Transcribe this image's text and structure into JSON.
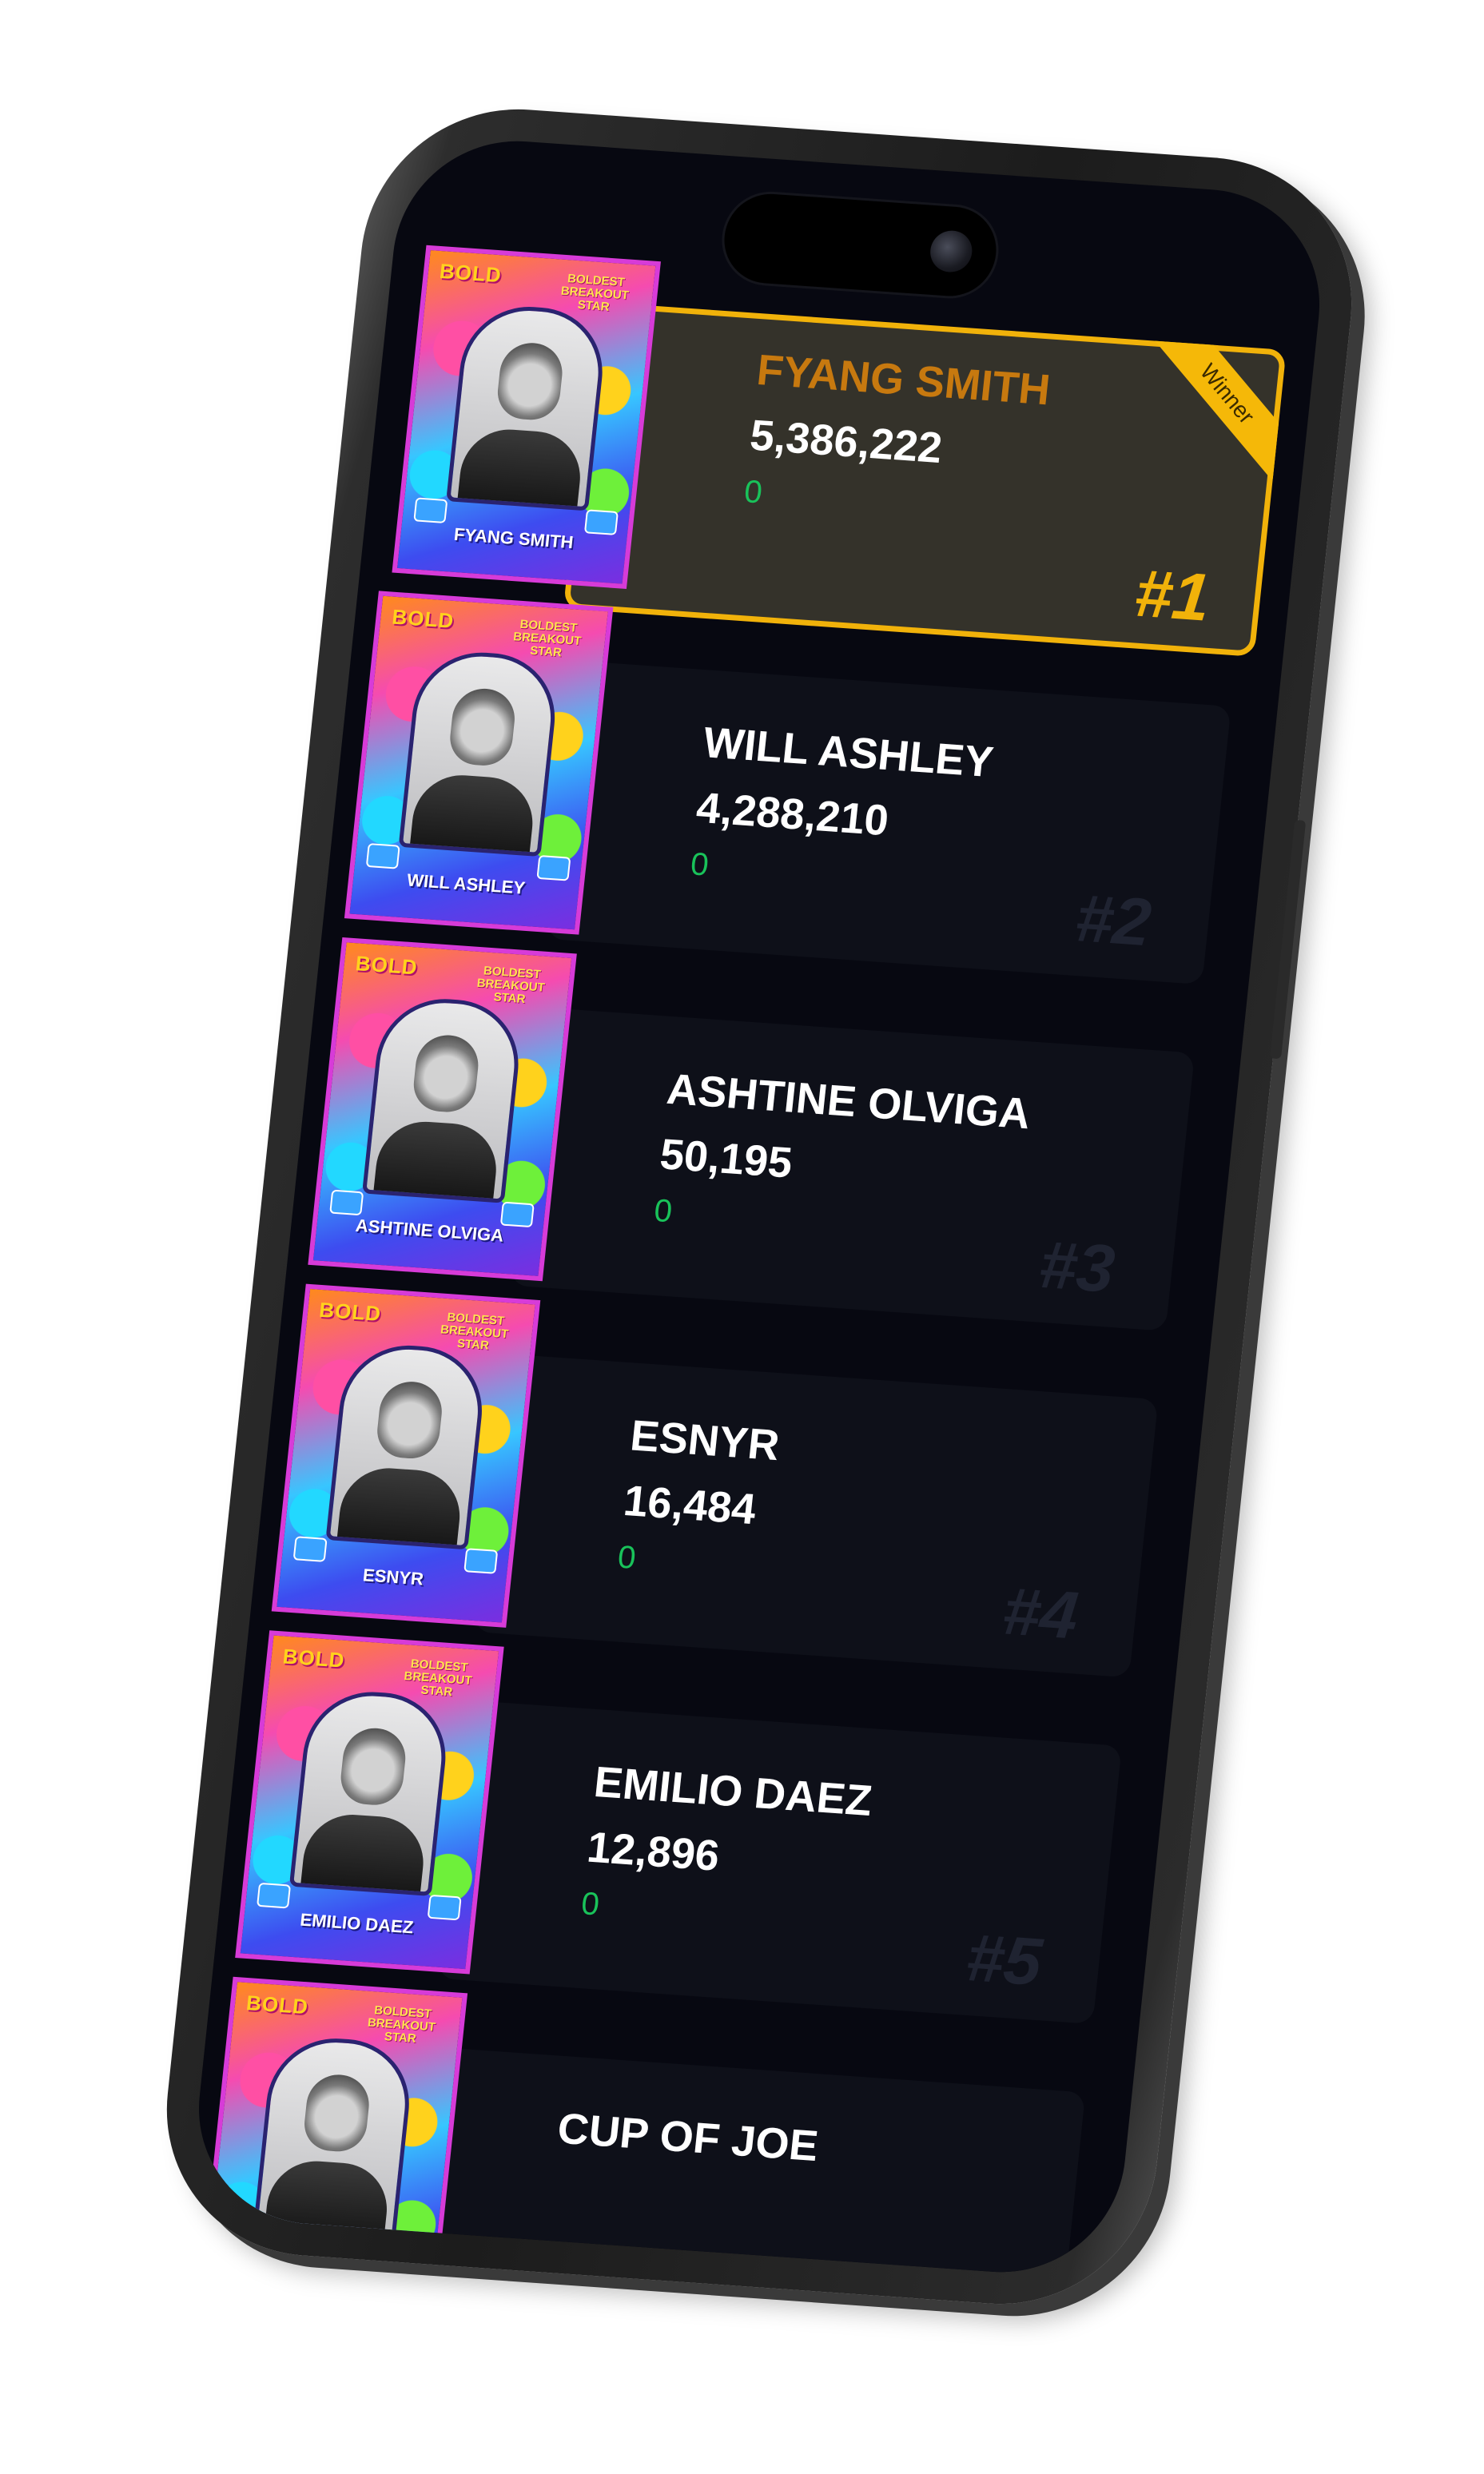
{
  "leaderboard": {
    "winner_label": "Winner",
    "thumb_logo": "BOLD",
    "thumb_subtitle": "BOLDEST BREAKOUT STAR",
    "entries": [
      {
        "rank": "#1",
        "name": "FYANG SMITH",
        "votes": "5,386,222",
        "change": "0",
        "thumb_name": "FYANG SMITH",
        "winner": true
      },
      {
        "rank": "#2",
        "name": "WILL ASHLEY",
        "votes": "4,288,210",
        "change": "0",
        "thumb_name": "WILL ASHLEY"
      },
      {
        "rank": "#3",
        "name": "ASHTINE OLVIGA",
        "votes": "50,195",
        "change": "0",
        "thumb_name": "ASHTINE OLVIGA"
      },
      {
        "rank": "#4",
        "name": "ESNYR",
        "votes": "16,484",
        "change": "0",
        "thumb_name": "ESNYR"
      },
      {
        "rank": "#5",
        "name": "EMILIO DAEZ",
        "votes": "12,896",
        "change": "0",
        "thumb_name": "EMILIO DAEZ"
      },
      {
        "rank": "",
        "name": "CUP OF JOE",
        "votes": "",
        "change": "",
        "thumb_name": ""
      }
    ]
  },
  "colors": {
    "winner_border": "#f1b20a",
    "winner_name": "#c7790f",
    "change_green": "#19c25a",
    "screen_bg": "#070811"
  }
}
